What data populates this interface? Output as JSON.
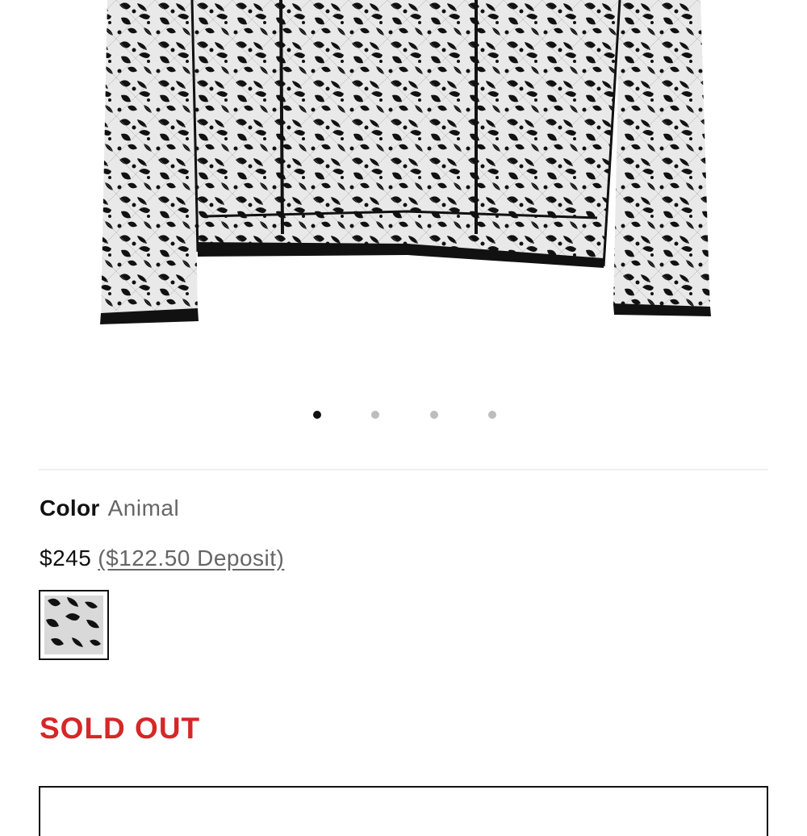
{
  "product": {
    "image_alt": "Black lace animal print jacket",
    "carousel": {
      "total": 4,
      "active_index": 0
    },
    "color_label": "Color",
    "color_value": "Animal",
    "price": "$245",
    "deposit_text": "($122.50 Deposit)",
    "swatch_name": "Animal",
    "status_text": "SOLD OUT"
  },
  "colors": {
    "sold_out": "#d62728",
    "text_primary": "#111111",
    "text_secondary": "#666666",
    "dot_active": "#111111",
    "dot_inactive": "#bdbdbd"
  }
}
